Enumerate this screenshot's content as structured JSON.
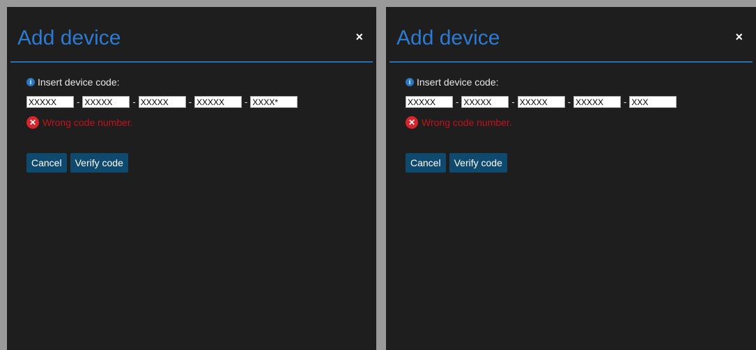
{
  "dialogs": [
    {
      "title": "Add device",
      "close_glyph": "×",
      "code_label": "Insert device code:",
      "code_fields": [
        "XXXXX",
        "XXXXX",
        "XXXXX",
        "XXXXX",
        "XXXX*"
      ],
      "separator": "-",
      "error_text": "Wrong code number.",
      "cancel_label": "Cancel",
      "verify_label": "Verify code"
    },
    {
      "title": "Add device",
      "close_glyph": "×",
      "code_label": "Insert device code:",
      "code_fields": [
        "XXXXX",
        "XXXXX",
        "XXXXX",
        "XXXXX",
        "XXX"
      ],
      "separator": "-",
      "error_text": "Wrong code number.",
      "cancel_label": "Cancel",
      "verify_label": "Verify code"
    }
  ],
  "colors": {
    "title": "#2b7bd4",
    "error": "#c0141a",
    "button": "#0f4a6e",
    "dialog_bg": "#1e1e1e"
  },
  "icons": {
    "info": "info-icon",
    "error": "error-icon",
    "close": "close-icon"
  }
}
